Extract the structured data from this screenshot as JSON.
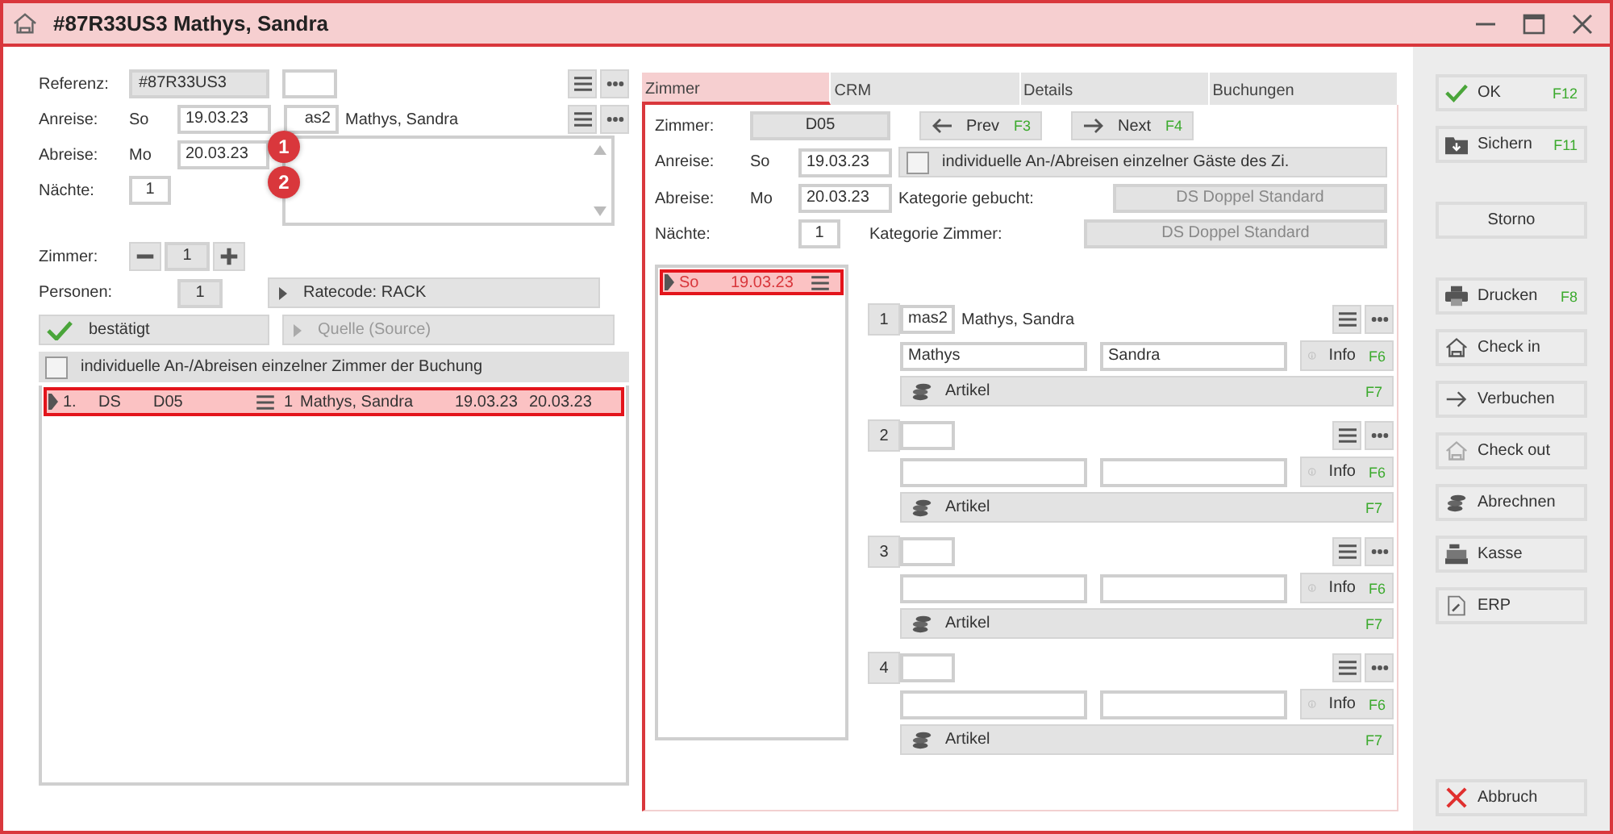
{
  "window": {
    "title": "#87R33US3 Mathys, Sandra"
  },
  "booking": {
    "reference": {
      "label": "Referenz:",
      "value": "#87R33US3"
    },
    "arrival": {
      "label": "Anreise:",
      "day": "So",
      "date": "19.03.23"
    },
    "guest": {
      "code": "as2",
      "name": "Mathys, Sandra"
    },
    "departure": {
      "label": "Abreise:",
      "day": "Mo",
      "date": "20.03.23"
    },
    "nights": {
      "label": "Nächte:",
      "value": "1"
    },
    "rooms": {
      "label": "Zimmer:",
      "value": "1"
    },
    "persons": {
      "label": "Personen:",
      "value": "1"
    },
    "ratecode": {
      "label": "Ratecode: RACK",
      "disabled": false
    },
    "source": {
      "label": "Quelle (Source)",
      "disabled": true
    },
    "status": {
      "label": "bestätigt",
      "checked": true
    },
    "individual": {
      "label": "individuelle An-/Abreisen einzelner Zimmer der Buchung",
      "checked": false
    },
    "markers": [
      "1",
      "2"
    ]
  },
  "room_list": [
    {
      "no": "1.",
      "category": "DS",
      "room": "D05",
      "count": "1",
      "name": "Mathys, Sandra",
      "from": "19.03.23",
      "to": "20.03.23",
      "selected": true
    }
  ],
  "tabs": [
    {
      "label": "Zimmer",
      "selected": true
    },
    {
      "label": "CRM",
      "selected": false
    },
    {
      "label": "Details",
      "selected": false
    },
    {
      "label": "Buchungen",
      "selected": false
    }
  ],
  "room_tab": {
    "room": {
      "label": "Zimmer:",
      "value": "D05"
    },
    "prev": {
      "label": "Prev",
      "key": "F3"
    },
    "next": {
      "label": "Next",
      "key": "F4"
    },
    "arrival": {
      "label": "Anreise:",
      "day": "So",
      "date": "19.03.23"
    },
    "departure": {
      "label": "Abreise:",
      "day": "Mo",
      "date": "20.03.23"
    },
    "nights": {
      "label": "Nächte:",
      "value": "1"
    },
    "individual": {
      "label": "individuelle An-/Abreisen einzelner Gäste des Zi.",
      "checked": false
    },
    "cat_booked": {
      "label": "Kategorie gebucht:",
      "value": "DS Doppel Standard"
    },
    "cat_room": {
      "label": "Kategorie Zimmer:",
      "value": "DS Doppel Standard"
    },
    "dates": [
      {
        "day": "So",
        "date": "19.03.23",
        "selected": true
      }
    ],
    "guests": [
      {
        "no": "1",
        "code": "mas2",
        "name": "Mathys, Sandra",
        "last": "Mathys",
        "first": "Sandra",
        "info": "Info",
        "info_key": "F6",
        "articles": "Artikel",
        "articles_key": "F7"
      },
      {
        "no": "2",
        "info": "Info",
        "info_key": "F6",
        "articles": "Artikel",
        "articles_key": "F7"
      },
      {
        "no": "3",
        "info": "Info",
        "info_key": "F6",
        "articles": "Artikel",
        "articles_key": "F7"
      },
      {
        "no": "4",
        "info": "Info",
        "info_key": "F6",
        "articles": "Artikel",
        "articles_key": "F7"
      }
    ]
  },
  "action_groups": [
    [
      {
        "label": "OK",
        "key": "F12",
        "kind": "check"
      },
      {
        "label": "Sichern",
        "key": "F11",
        "kind": "save"
      }
    ],
    [
      {
        "label": "Storno",
        "kind": "none"
      }
    ],
    [
      {
        "label": "Drucken",
        "key": "F8",
        "kind": "print"
      },
      {
        "label": "Check in",
        "kind": "house"
      },
      {
        "label": "Verbuchen",
        "kind": "arrow"
      },
      {
        "label": "Check out",
        "kind": "house-light"
      },
      {
        "label": "Abrechnen",
        "kind": "coins"
      },
      {
        "label": "Kasse",
        "kind": "register"
      },
      {
        "label": "ERP",
        "kind": "document"
      }
    ],
    [
      {
        "label": "Abbruch",
        "kind": "cross"
      }
    ]
  ]
}
